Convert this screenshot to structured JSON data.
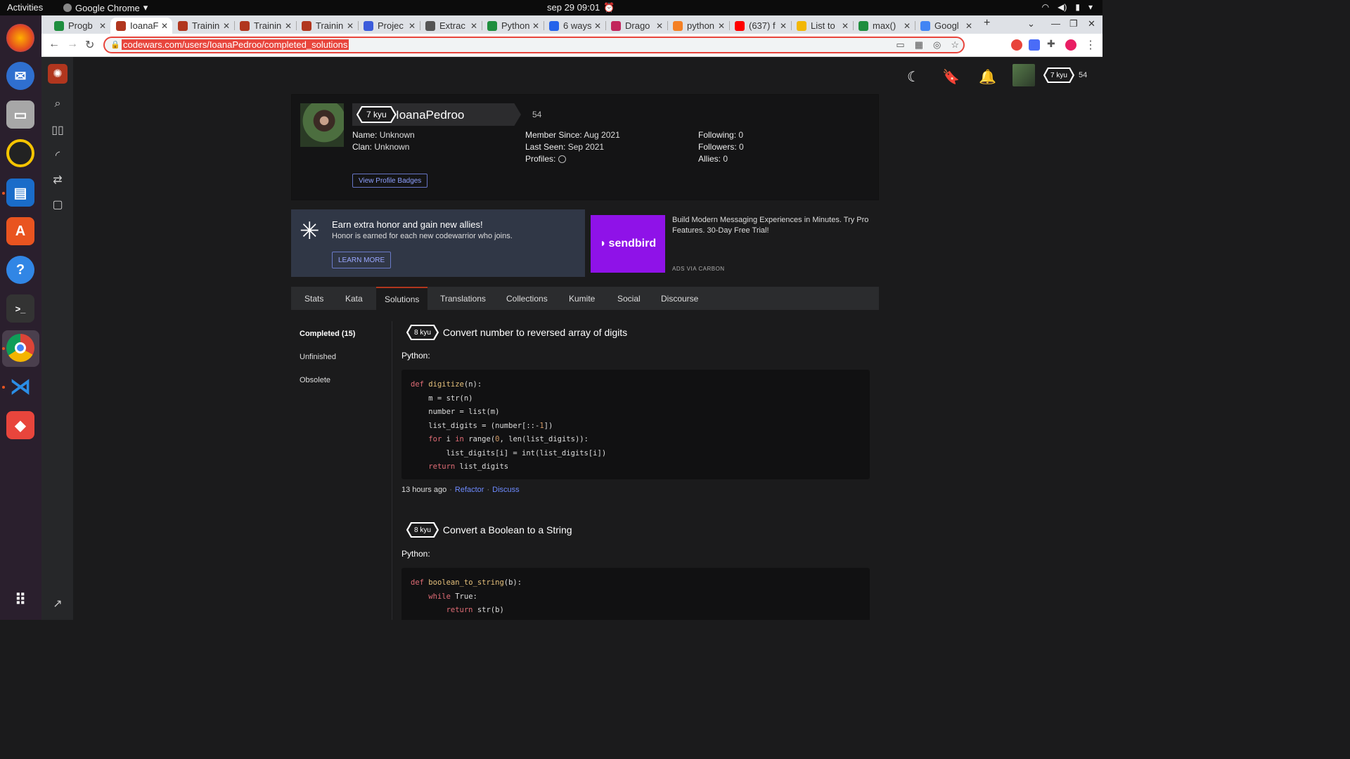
{
  "os": {
    "activities": "Activities",
    "app_name": "Google Chrome",
    "clock": "sep 29  09:01"
  },
  "browser": {
    "tabs": [
      {
        "label": "Progb",
        "color": "#1e8e3e"
      },
      {
        "label": "IoanaF",
        "color": "#b1361e"
      },
      {
        "label": "Trainin",
        "color": "#b1361e"
      },
      {
        "label": "Trainin",
        "color": "#b1361e"
      },
      {
        "label": "Trainin",
        "color": "#b1361e"
      },
      {
        "label": "Projec",
        "color": "#3b5bdb"
      },
      {
        "label": "Extrac",
        "color": "#555555"
      },
      {
        "label": "Python",
        "color": "#1e8e3e"
      },
      {
        "label": "6 ways",
        "color": "#2563eb"
      },
      {
        "label": "Drago",
        "color": "#c2255c"
      },
      {
        "label": "python",
        "color": "#f48024"
      },
      {
        "label": "(637) f",
        "color": "#ff0000"
      },
      {
        "label": "List to",
        "color": "#f2b705"
      },
      {
        "label": "max()",
        "color": "#1e8e3e"
      },
      {
        "label": "Googl",
        "color": "#4285f4"
      }
    ],
    "url": "codewars.com/users/IoanaPedroo/completed_solutions"
  },
  "header": {
    "rank": "7 kyu",
    "honor": "54"
  },
  "profile": {
    "rank": "7 kyu",
    "username": "IoanaPedroo",
    "honor": "54",
    "name_label": "Name:",
    "name_value": "Unknown",
    "clan_label": "Clan:",
    "clan_value": "Unknown",
    "member_since_label": "Member Since:",
    "member_since_value": "Aug 2021",
    "last_seen_label": "Last Seen:",
    "last_seen_value": "Sep 2021",
    "profiles_label": "Profiles:",
    "following_label": "Following:",
    "following_value": "0",
    "followers_label": "Followers:",
    "followers_value": "0",
    "allies_label": "Allies:",
    "allies_value": "0",
    "badges_button": "View Profile Badges"
  },
  "banner": {
    "heading": "Earn extra honor and gain new allies!",
    "sub": "Honor is earned for each new codewarrior who joins.",
    "button": "LEARN MORE"
  },
  "ad": {
    "logo": "sendbird",
    "text": "Build Modern Messaging Experiences in Minutes. Try Pro Features. 30-Day Free Trial!",
    "via": "ADS VIA CARBON"
  },
  "profile_tabs": [
    "Stats",
    "Kata",
    "Solutions",
    "Translations",
    "Collections",
    "Kumite",
    "Social",
    "Discourse"
  ],
  "subnav": {
    "completed": "Completed (15)",
    "unfinished": "Unfinished",
    "obsolete": "Obsolete"
  },
  "solutions": [
    {
      "kyu": "8 kyu",
      "title": "Convert number to reversed array of digits",
      "language": "Python:",
      "time": "13 hours ago",
      "refactor": "Refactor",
      "discuss": "Discuss"
    },
    {
      "kyu": "8 kyu",
      "title": "Convert a Boolean to a String",
      "language": "Python:"
    }
  ]
}
